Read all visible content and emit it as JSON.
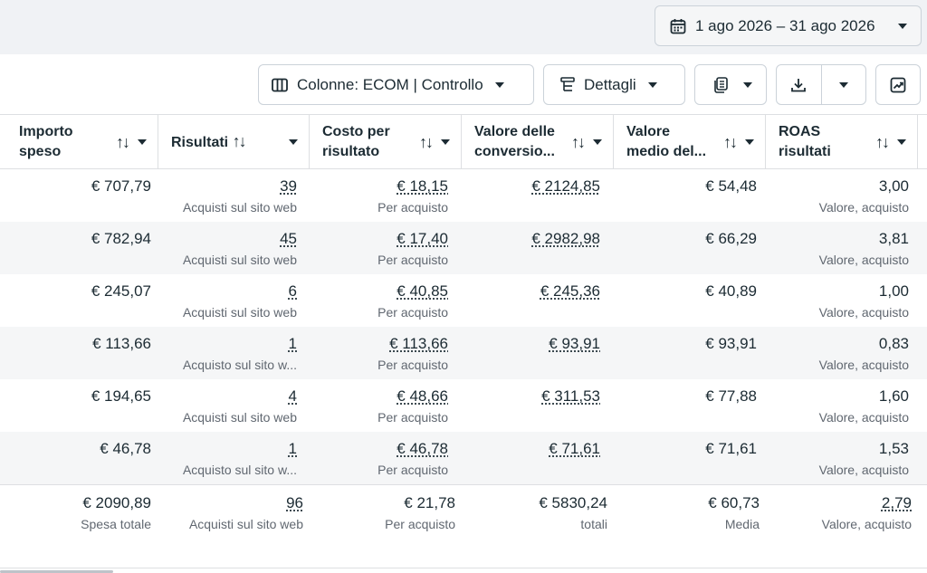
{
  "date_range": {
    "label": "1 ago 2026 – 31 ago 2026"
  },
  "toolbar": {
    "columns_label": "Colonne: ECOM | Controllo",
    "details_label": "Dettagli"
  },
  "icons": {
    "calendar": "calendar-icon",
    "columns": "columns-icon",
    "details": "breakdown-icon",
    "reports": "reports-icon",
    "export": "download-icon",
    "chart": "chart-icon",
    "caret": "caret-down-icon"
  },
  "table": {
    "headers": [
      {
        "line1": "Importo",
        "line2": "speso"
      },
      {
        "line1": "Risultati",
        "line2": ""
      },
      {
        "line1": "Costo per",
        "line2": "risultato"
      },
      {
        "line1": "Valore delle",
        "line2": "conversio..."
      },
      {
        "line1": "Valore",
        "line2": "medio del..."
      },
      {
        "line1": "ROAS",
        "line2": "risultati"
      }
    ],
    "sort_symbol": "↑↓",
    "rows": [
      {
        "spend": "€ 707,79",
        "results": "39",
        "results_sub": "Acquisti sul sito web",
        "cpr": "€ 18,15",
        "cpr_sub": "Per acquisto",
        "conv_value": "€ 2124,85",
        "avg_value": "€ 54,48",
        "roas": "3,00",
        "roas_sub": "Valore, acquisto"
      },
      {
        "spend": "€ 782,94",
        "results": "45",
        "results_sub": "Acquisti sul sito web",
        "cpr": "€ 17,40",
        "cpr_sub": "Per acquisto",
        "conv_value": "€ 2982,98",
        "avg_value": "€ 66,29",
        "roas": "3,81",
        "roas_sub": "Valore, acquisto"
      },
      {
        "spend": "€ 245,07",
        "results": "6",
        "results_sub": "Acquisti sul sito web",
        "cpr": "€ 40,85",
        "cpr_sub": "Per acquisto",
        "conv_value": "€ 245,36",
        "avg_value": "€ 40,89",
        "roas": "1,00",
        "roas_sub": "Valore, acquisto"
      },
      {
        "spend": "€ 113,66",
        "results": "1",
        "results_sub": "Acquisto sul sito w...",
        "cpr": "€ 113,66",
        "cpr_sub": "Per acquisto",
        "conv_value": "€ 93,91",
        "avg_value": "€ 93,91",
        "roas": "0,83",
        "roas_sub": "Valore, acquisto"
      },
      {
        "spend": "€ 194,65",
        "results": "4",
        "results_sub": "Acquisti sul sito web",
        "cpr": "€ 48,66",
        "cpr_sub": "Per acquisto",
        "conv_value": "€ 311,53",
        "avg_value": "€ 77,88",
        "roas": "1,60",
        "roas_sub": "Valore, acquisto"
      },
      {
        "spend": "€ 46,78",
        "results": "1",
        "results_sub": "Acquisto sul sito w...",
        "cpr": "€ 46,78",
        "cpr_sub": "Per acquisto",
        "conv_value": "€ 71,61",
        "avg_value": "€ 71,61",
        "roas": "1,53",
        "roas_sub": "Valore, acquisto"
      }
    ],
    "totals": {
      "spend": "€ 2090,89",
      "spend_sub": "Spesa totale",
      "results": "96",
      "results_sub": "Acquisti sul sito web",
      "cpr": "€ 21,78",
      "cpr_sub": "Per acquisto",
      "conv_value": "€ 5830,24",
      "conv_value_sub": "totali",
      "avg_value": "€ 60,73",
      "avg_value_sub": "Media",
      "roas": "2,79",
      "roas_sub": "Valore, acquisto"
    }
  }
}
